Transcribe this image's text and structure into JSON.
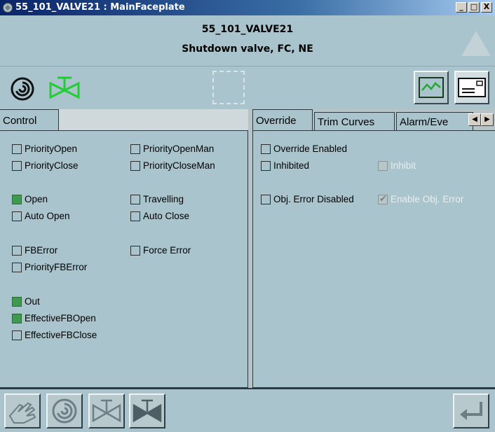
{
  "window": {
    "title": "55_101_VALVE21 : MainFaceplate",
    "controls": {
      "minimize": "_",
      "maximize": "□",
      "close": "X"
    }
  },
  "header": {
    "tag": "55_101_VALVE21",
    "description": "Shutdown valve, FC, NE"
  },
  "colors": {
    "panel_bg": "#a9c4cd",
    "indicator_on": "#3e9a4e",
    "valve_icon": "#22cc33"
  },
  "left_tabs": [
    {
      "label": "Control",
      "active": true
    }
  ],
  "right_tabs": [
    {
      "label": "Override",
      "active": true
    },
    {
      "label": "Trim Curves",
      "active": false
    },
    {
      "label": "Alarm/Eve",
      "active": false
    }
  ],
  "control": {
    "col1": [
      {
        "label": "PriorityOpen",
        "checked": false
      },
      {
        "label": "PriorityClose",
        "checked": false
      },
      {
        "label": "Open",
        "checked": true
      },
      {
        "label": "Auto Open",
        "checked": false
      },
      {
        "label": "FBError",
        "checked": false
      },
      {
        "label": "PriorityFBError",
        "checked": false
      },
      {
        "label": "Out",
        "checked": true
      },
      {
        "label": "EffectiveFBOpen",
        "checked": true
      },
      {
        "label": "EffectiveFBClose",
        "checked": false
      }
    ],
    "col2": [
      {
        "label": "PriorityOpenMan",
        "checked": false
      },
      {
        "label": "PriorityCloseMan",
        "checked": false
      },
      {
        "label": "Travelling",
        "checked": false
      },
      {
        "label": "Auto Close",
        "checked": false
      },
      {
        "label": "Force Error",
        "checked": false
      }
    ]
  },
  "override": {
    "items": [
      {
        "label": "Override Enabled",
        "checked": false
      },
      {
        "label": "Inhibited",
        "checked": false
      },
      {
        "label": "Obj. Error Disabled",
        "checked": false
      }
    ],
    "disabled_items": [
      {
        "label": "Inhibit",
        "checked": false
      },
      {
        "label": "Enable Obj. Error",
        "checked": true
      }
    ]
  },
  "icons": {
    "mode": "auto-spiral-icon",
    "valve": "valve-open-icon",
    "trend": "trend-icon",
    "info": "faceplate-info-icon",
    "alarm": "alarm-triangle-icon",
    "bottom": [
      "manual-hand-icon",
      "auto-spiral-icon",
      "open-valve-icon",
      "close-valve-icon",
      "enter-icon"
    ]
  }
}
